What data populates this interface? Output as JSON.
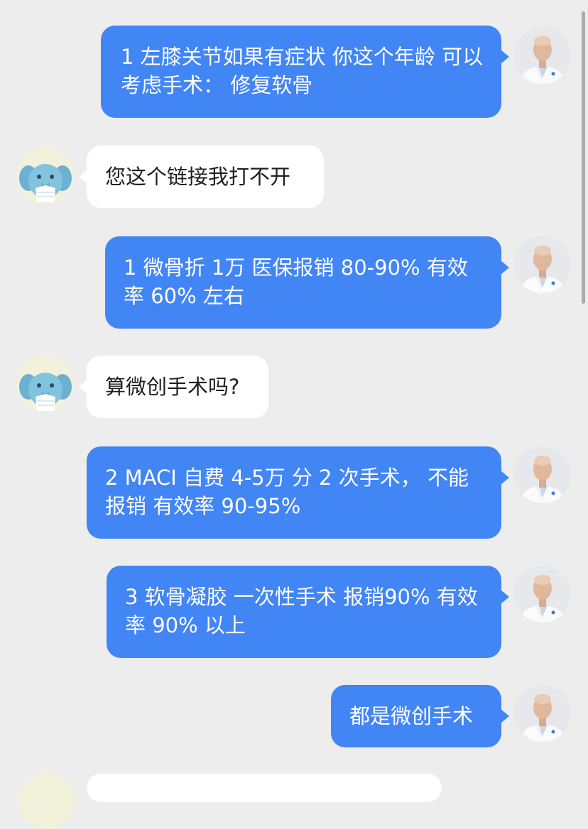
{
  "conversation": {
    "messages": [
      {
        "sender": "doctor",
        "text": "1 左膝关节如果有症状 你这个年龄 可以考虑手术： 修复软骨"
      },
      {
        "sender": "patient",
        "text": "您这个链接我打不开"
      },
      {
        "sender": "doctor",
        "text": "1 微骨折 1万 医保报销 80-90% 有效率 60% 左右"
      },
      {
        "sender": "patient",
        "text": "算微创手术吗?"
      },
      {
        "sender": "doctor",
        "text": "2 MACI 自费 4-5万 分 2 次手术， 不能报销 有效率 90-95%"
      },
      {
        "sender": "doctor",
        "text": "3 软骨凝胶 一次性手术 报销90% 有效率 90% 以上"
      },
      {
        "sender": "doctor",
        "text": "都是微创手术"
      }
    ]
  },
  "avatars": {
    "doctor": "doctor-avatar",
    "patient": "elephant-avatar"
  },
  "colors": {
    "background": "#ededed",
    "outgoing_bubble": "#4285f4",
    "incoming_bubble": "#ffffff",
    "outgoing_text": "#ffffff",
    "incoming_text": "#1f1f1f"
  }
}
